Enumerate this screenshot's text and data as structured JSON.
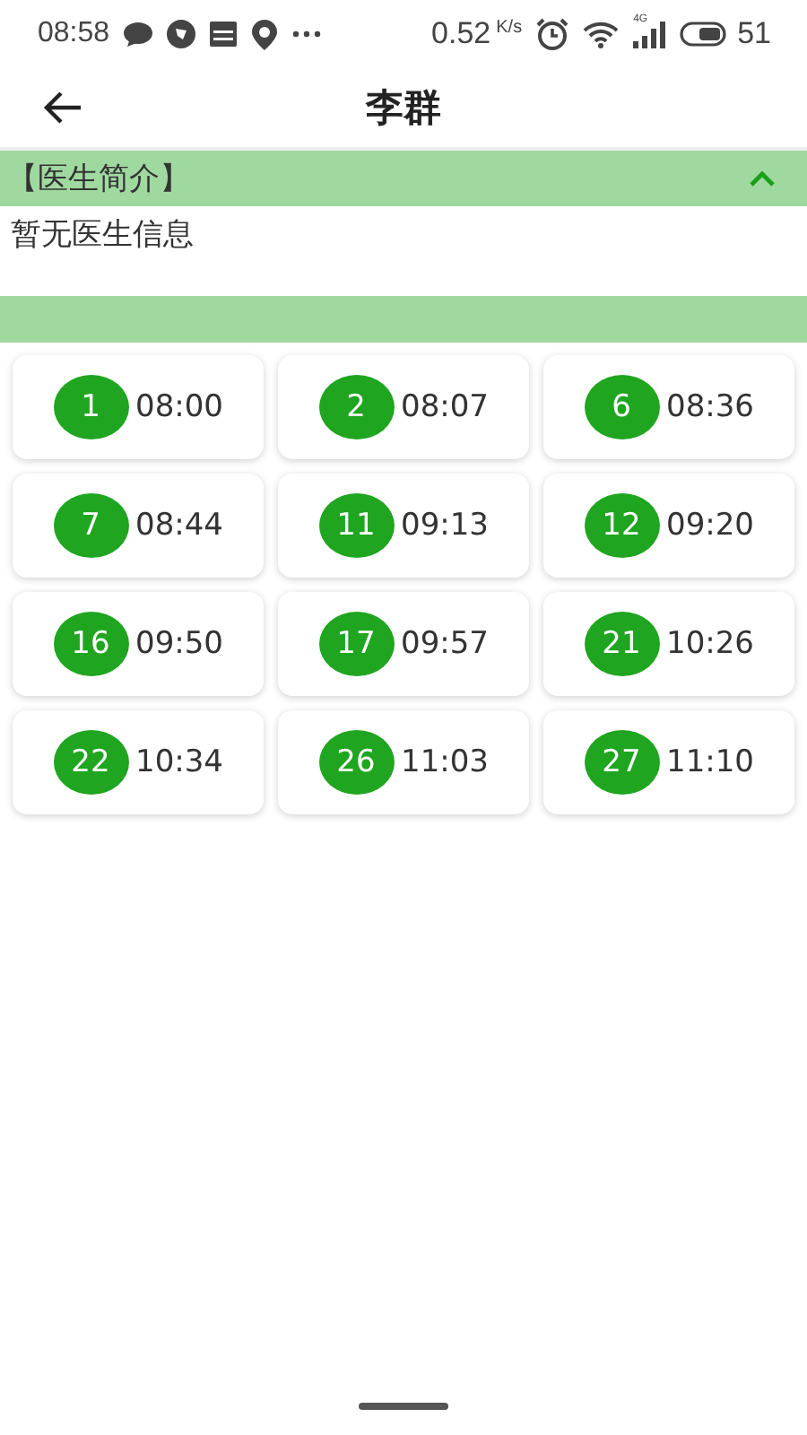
{
  "status_bar": {
    "time": "08:58",
    "speed": "0.52",
    "speed_unit": "K/s",
    "network": "4G",
    "battery": "51"
  },
  "header": {
    "title": "李群"
  },
  "doctor_intro": {
    "title": "【医生简介】",
    "expanded": true,
    "text": "暂无医生信息"
  },
  "slots": [
    {
      "number": "1",
      "time": "08:00"
    },
    {
      "number": "2",
      "time": "08:07"
    },
    {
      "number": "6",
      "time": "08:36"
    },
    {
      "number": "7",
      "time": "08:44"
    },
    {
      "number": "11",
      "time": "09:13"
    },
    {
      "number": "12",
      "time": "09:20"
    },
    {
      "number": "16",
      "time": "09:50"
    },
    {
      "number": "17",
      "time": "09:57"
    },
    {
      "number": "21",
      "time": "10:26"
    },
    {
      "number": "22",
      "time": "10:34"
    },
    {
      "number": "26",
      "time": "11:03"
    },
    {
      "number": "27",
      "time": "11:10"
    }
  ]
}
